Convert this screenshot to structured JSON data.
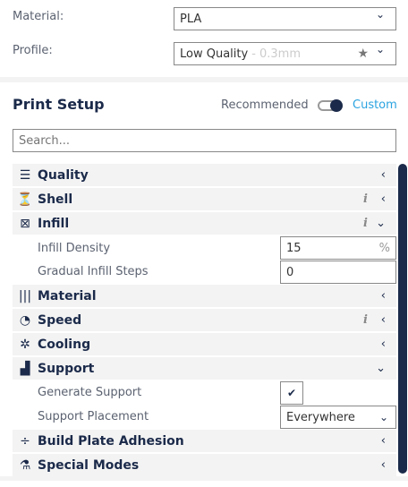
{
  "material": {
    "label": "Material:",
    "value": "PLA"
  },
  "profile": {
    "label": "Profile:",
    "value": "Low Quality",
    "detail": "- 0.3mm"
  },
  "print_setup": {
    "title": "Print Setup",
    "recommended": "Recommended",
    "custom": "Custom",
    "mode": "custom",
    "search_placeholder": "Search..."
  },
  "categories": [
    {
      "label": "Quality",
      "icon": "quality-icon",
      "glyph": "☰",
      "info": false,
      "expanded": false
    },
    {
      "label": "Shell",
      "icon": "shell-icon",
      "glyph": "⏳",
      "info": true,
      "expanded": false
    },
    {
      "label": "Infill",
      "icon": "infill-icon",
      "glyph": "⊠",
      "info": true,
      "expanded": true
    },
    {
      "label": "Material",
      "icon": "material-icon",
      "glyph": "|||",
      "info": false,
      "expanded": false
    },
    {
      "label": "Speed",
      "icon": "speed-icon",
      "glyph": "◔",
      "info": true,
      "expanded": false
    },
    {
      "label": "Cooling",
      "icon": "cooling-icon",
      "glyph": "✲",
      "info": false,
      "expanded": false
    },
    {
      "label": "Support",
      "icon": "support-icon",
      "glyph": "▟",
      "info": false,
      "expanded": true
    },
    {
      "label": "Build Plate Adhesion",
      "icon": "build-plate-adhesion-icon",
      "glyph": "÷",
      "info": false,
      "expanded": false
    },
    {
      "label": "Special Modes",
      "icon": "special-modes-icon",
      "glyph": "⚗",
      "info": false,
      "expanded": false
    }
  ],
  "infill": {
    "density_label": "Infill Density",
    "density_value": "15",
    "density_unit": "%",
    "gradual_label": "Gradual Infill Steps",
    "gradual_value": "0"
  },
  "support": {
    "generate_label": "Generate Support",
    "generate_checked": true,
    "check_glyph": "✔",
    "placement_label": "Support Placement",
    "placement_value": "Everywhere"
  },
  "glyphs": {
    "chevron_down": "⌄",
    "chevron_left": "‹",
    "info": "i",
    "star": "★"
  },
  "colors": {
    "accent": "#2aa3e0",
    "navy": "#1b2a4a",
    "panel": "#f3f3f3"
  }
}
